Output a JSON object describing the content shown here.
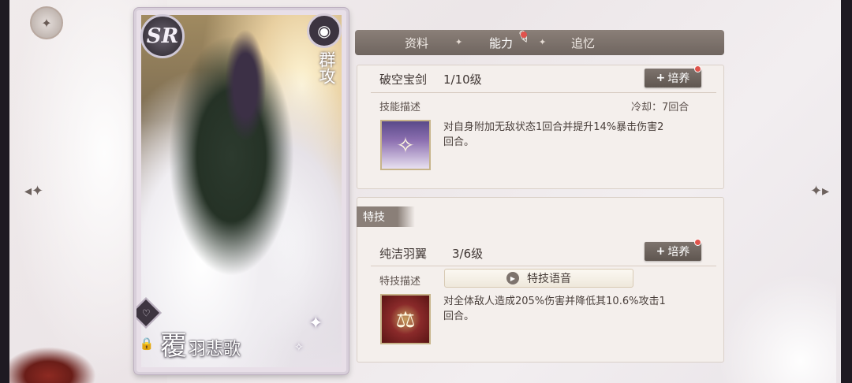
{
  "card": {
    "rarity": "SR",
    "attack_type": "群攻",
    "name_first": "覆",
    "name_rest": "羽悲歌"
  },
  "tabs": [
    {
      "label": "资料"
    },
    {
      "label": "能力"
    },
    {
      "label": "追忆"
    }
  ],
  "active_tab": "能力",
  "skill": {
    "name": "破空宝剑",
    "level": "1/10级",
    "train_label": "培养",
    "desc_label": "技能描述",
    "cooldown": "冷却：7回合",
    "description_line1": "对自身附加无敌状态1回合并提升14%暴击伤害2",
    "description_line2": "回合。"
  },
  "special": {
    "section_label": "特技",
    "name": "纯洁羽翼",
    "level": "3/6级",
    "train_label": "培养",
    "desc_label": "特技描述",
    "voice_label": "特技语音",
    "description_line1": "对全体敌人造成205%伤害并降低其10.6%攻击1",
    "description_line2": "回合。"
  },
  "icons": {
    "home": "compass-icon",
    "left": "arrow-left-icon",
    "right": "arrow-right-icon",
    "skill": "angel-icon",
    "special": "scales-icon"
  },
  "colors": {
    "tab_bar": "#7d736d",
    "alert_dot": "#e0544c"
  }
}
